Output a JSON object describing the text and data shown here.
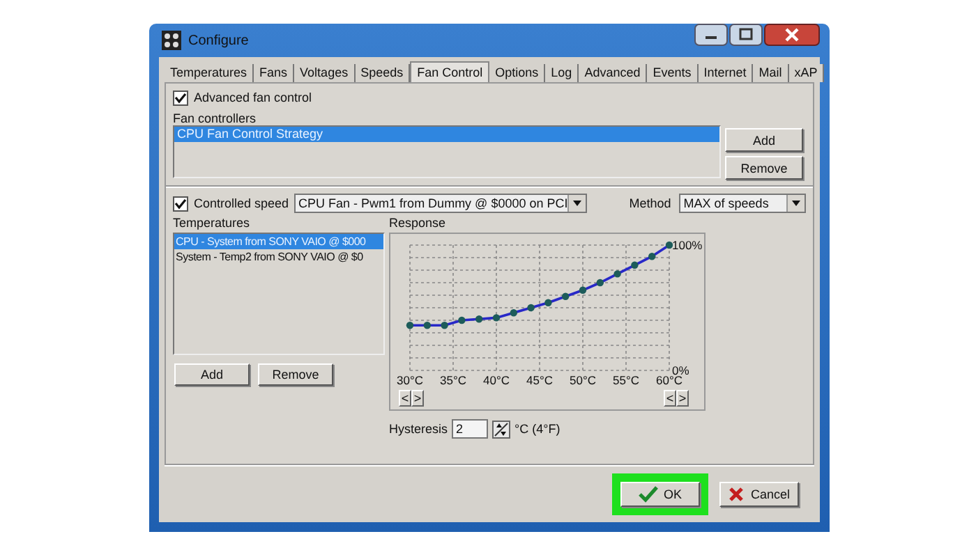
{
  "window": {
    "title": "Configure"
  },
  "tabs": [
    {
      "label": "Temperatures",
      "selected": false
    },
    {
      "label": "Fans",
      "selected": false
    },
    {
      "label": "Voltages",
      "selected": false
    },
    {
      "label": "Speeds",
      "selected": false
    },
    {
      "label": "Fan Control",
      "selected": true
    },
    {
      "label": "Options",
      "selected": false
    },
    {
      "label": "Log",
      "selected": false
    },
    {
      "label": "Advanced",
      "selected": false
    },
    {
      "label": "Events",
      "selected": false
    },
    {
      "label": "Internet",
      "selected": false
    },
    {
      "label": "Mail",
      "selected": false
    },
    {
      "label": "xAP",
      "selected": false
    }
  ],
  "advanced_fan_control": {
    "label": "Advanced fan control",
    "checked": true
  },
  "fan_controllers": {
    "label": "Fan controllers",
    "items": [
      {
        "text": "CPU Fan Control Strategy",
        "selected": true
      }
    ],
    "buttons": [
      "Add",
      "Remove"
    ]
  },
  "controlled_speed": {
    "label": "Controlled speed",
    "checked": true,
    "value": "CPU Fan - Pwm1 from Dummy @ $0000 on PCI"
  },
  "method": {
    "label": "Method",
    "value": "MAX of speeds"
  },
  "temperatures": {
    "label": "Temperatures",
    "items": [
      {
        "text": "CPU - System from SONY VAIO @ $000",
        "selected": true
      },
      {
        "text": "System - Temp2 from SONY VAIO @ $0",
        "selected": false
      }
    ],
    "buttons": [
      "Add",
      "Remove"
    ]
  },
  "response": {
    "label": "Response",
    "left_nav": [
      "<",
      ">"
    ],
    "right_nav": [
      "<",
      ">"
    ],
    "chart_data": {
      "type": "line",
      "x": [
        30,
        32,
        34,
        36,
        38,
        40,
        42,
        44,
        46,
        48,
        50,
        52,
        54,
        56,
        58,
        60
      ],
      "series": [
        {
          "color": "#2828c8",
          "marker": "circle",
          "values": [
            36,
            36,
            36,
            40,
            41,
            42,
            46,
            50,
            54,
            59,
            64,
            70,
            77,
            84,
            91,
            100
          ]
        }
      ],
      "grid": true,
      "xlim": [
        30,
        60
      ],
      "ylim": [
        0,
        100
      ],
      "xticks": [
        {
          "value": 30,
          "label": "30°C"
        },
        {
          "value": 35,
          "label": "35°C"
        },
        {
          "value": 40,
          "label": "40°C"
        },
        {
          "value": 45,
          "label": "45°C"
        },
        {
          "value": 50,
          "label": "50°C"
        },
        {
          "value": 55,
          "label": "55°C"
        },
        {
          "value": 60,
          "label": "60°C"
        }
      ],
      "yticks": [
        {
          "value": 0,
          "label": "0%"
        },
        {
          "value": 100,
          "label": "100%"
        }
      ]
    }
  },
  "hysteresis": {
    "label": "Hysteresis",
    "value": "2",
    "unit": "°C (4°F)"
  },
  "buttons": [
    {
      "label": "OK",
      "kind": "ok",
      "highlighted": true
    },
    {
      "label": "Cancel",
      "kind": "cancel",
      "highlighted": false
    }
  ]
}
